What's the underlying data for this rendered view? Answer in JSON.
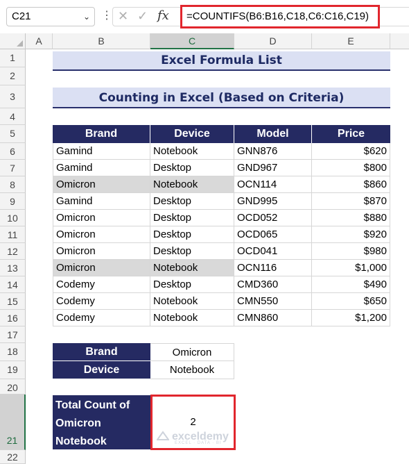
{
  "formula_bar": {
    "name_box": "C21",
    "formula": "=COUNTIFS(B6:B16,C18,C6:C16,C19)"
  },
  "columns": [
    "A",
    "B",
    "C",
    "D",
    "E"
  ],
  "active_column": "C",
  "rows": [
    "1",
    "2",
    "3",
    "4",
    "5",
    "6",
    "7",
    "8",
    "9",
    "10",
    "11",
    "12",
    "13",
    "14",
    "15",
    "16",
    "17",
    "18",
    "19",
    "20",
    "21",
    "22"
  ],
  "active_row": "21",
  "title": "Excel Formula List",
  "subtitle": "Counting in Excel (Based on Criteria)",
  "table": {
    "headers": [
      "Brand",
      "Device",
      "Model",
      "Price"
    ],
    "rows": [
      [
        "Gamind",
        "Notebook",
        "GNN876",
        "$620"
      ],
      [
        "Gamind",
        "Desktop",
        "GND967",
        "$800"
      ],
      [
        "Omicron",
        "Notebook",
        "OCN114",
        "$860"
      ],
      [
        "Gamind",
        "Desktop",
        "GND995",
        "$870"
      ],
      [
        "Omicron",
        "Desktop",
        "OCD052",
        "$880"
      ],
      [
        "Omicron",
        "Desktop",
        "OCD065",
        "$920"
      ],
      [
        "Omicron",
        "Desktop",
        "OCD041",
        "$980"
      ],
      [
        "Omicron",
        "Notebook",
        "OCN116",
        "$1,000"
      ],
      [
        "Codemy",
        "Desktop",
        "CMD360",
        "$490"
      ],
      [
        "Codemy",
        "Notebook",
        "CMN550",
        "$650"
      ],
      [
        "Codemy",
        "Notebook",
        "CMN860",
        "$1,200"
      ]
    ],
    "highlighted_rows": [
      2,
      7
    ]
  },
  "criteria": {
    "brand_label": "Brand",
    "brand_value": "Omicron",
    "device_label": "Device",
    "device_value": "Notebook"
  },
  "result": {
    "label_lines": [
      "Total Count of",
      "Omicron",
      "Notebook"
    ],
    "value": "2"
  },
  "watermark": {
    "name": "exceldemy",
    "tagline": "EXCEL · DATA · BI"
  },
  "colors": {
    "header_fill": "#252a62",
    "banner_fill": "#dbe0f3",
    "highlight_fill": "#d9d9d9",
    "red_outline": "#e1262d",
    "excel_green": "#217346"
  }
}
